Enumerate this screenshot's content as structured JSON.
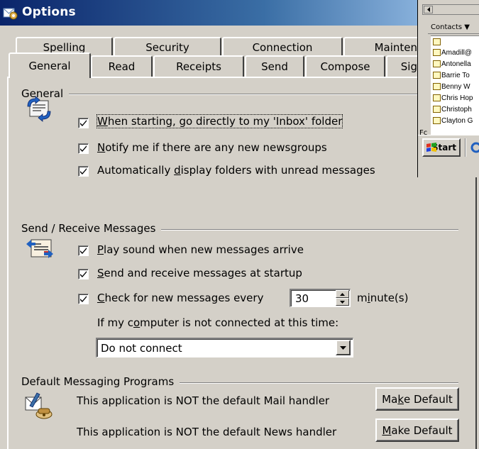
{
  "dialog": {
    "title": "Options"
  },
  "tabs": {
    "back": [
      "Spelling",
      "Security",
      "Connection",
      "Mainten"
    ],
    "front": [
      "General",
      "Read",
      "Receipts",
      "Send",
      "Compose",
      "Sig"
    ],
    "selected": "General"
  },
  "general": {
    "group_label": "General",
    "opt1": {
      "pre": "",
      "key": "W",
      "post": "hen starting, go directly to my 'Inbox' folder",
      "checked": true
    },
    "opt2": {
      "pre": "",
      "key": "N",
      "post": "otify me if there are any new newsgroups",
      "checked": true
    },
    "opt3": {
      "pre": "Automatically ",
      "key": "d",
      "post": "isplay folders with unread messages",
      "checked": true
    }
  },
  "sendrecv": {
    "group_label": "Send / Receive Messages",
    "opt1": {
      "pre": "",
      "key": "P",
      "post": "lay sound when new messages arrive",
      "checked": true
    },
    "opt2": {
      "pre": "",
      "key": "S",
      "post": "end and receive messages at startup",
      "checked": true
    },
    "opt3": {
      "pre": "",
      "key": "C",
      "post": "heck for new messages every",
      "checked": true
    },
    "interval_value": "30",
    "units": {
      "pre": "m",
      "key": "i",
      "post": "nute(s)"
    },
    "not_connected": {
      "pre": "If my c",
      "key": "o",
      "post": "mputer is not connected at this time:"
    },
    "connect_option": "Do not connect"
  },
  "defaults": {
    "group_label": "Default Messaging Programs",
    "mail_text": "This application is NOT the default Mail handler",
    "news_text": "This application is NOT the default News handler",
    "mail_button": {
      "pre": "Ma",
      "key": "k",
      "post": "e Default"
    },
    "news_button": {
      "pre": "",
      "key": "M",
      "post": "ake Default"
    }
  },
  "background": {
    "contacts_label": "Contacts ▼",
    "contacts": [
      "Amadill@",
      "Antonella",
      "Barrie To",
      "Benny W",
      "Chris Hop",
      "Christoph",
      "Clayton G"
    ],
    "fc_label": "Fc",
    "start_label": "Start"
  },
  "colors": {
    "title_gradient_start": "#0a246a",
    "title_gradient_end": "#a6caf0",
    "face": "#d4d0c8"
  },
  "icons": [
    "options-app-icon",
    "sync-mail-icon",
    "send-receive-icon",
    "default-programs-icon",
    "check-icon",
    "spin-up-icon",
    "spin-down-icon",
    "dropdown-arrow-icon",
    "contact-card-icon",
    "windows-logo-icon"
  ]
}
